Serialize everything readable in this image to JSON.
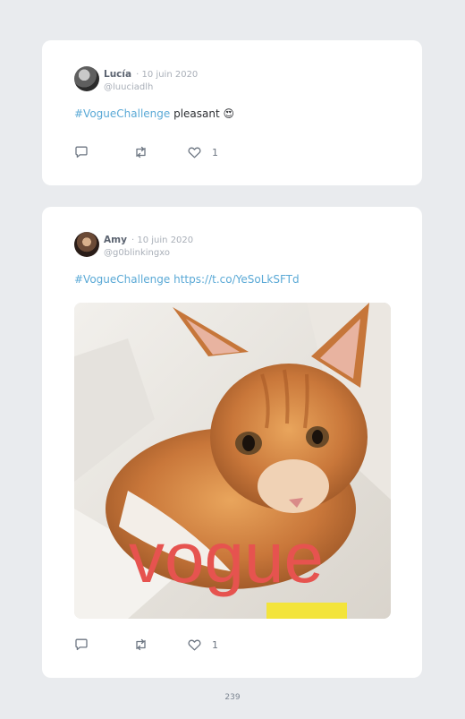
{
  "tweets": [
    {
      "name": "Lucía",
      "date": "· 10 juin 2020",
      "handle": "@luuciadlh",
      "hashtag": "#VogueChallenge",
      "text": " pleasant 😍",
      "likes": "1"
    },
    {
      "name": "Amy",
      "date": "· 10 juin 2020",
      "handle": "@g0blinkingxo",
      "hashtag": "#VogueChallenge",
      "link": " https://t.co/YeSoLkSFTd",
      "image_text": "vogue",
      "likes": "1"
    }
  ],
  "page_number": "239",
  "icons": {
    "reply": "reply-icon",
    "retweet": "retweet-icon",
    "like": "heart-icon"
  },
  "colors": {
    "background": "#e9ebee",
    "card": "#ffffff",
    "hashtag": "#5aa9d6",
    "image_text": "#e6534f"
  }
}
